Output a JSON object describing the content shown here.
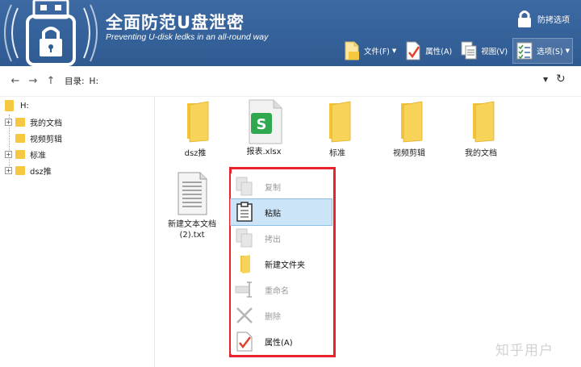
{
  "header": {
    "title": "全面防范U盘泄密",
    "subtitle": "Preventing U-disk ledks in an all-round way",
    "lock_label": "防拷选项",
    "logo_icon": "usb-lock-icon"
  },
  "toolbar": {
    "file": "文件(F)",
    "properties": "属性(A)",
    "view": "视图(V)",
    "options": "选项(S)"
  },
  "address": {
    "label": "目录:",
    "value": "H:"
  },
  "tree": {
    "root": "H:",
    "items": [
      {
        "label": "我的文档",
        "expandable": true
      },
      {
        "label": "视频剪辑",
        "expandable": false
      },
      {
        "label": "标准",
        "expandable": true
      },
      {
        "label": "dsz推",
        "expandable": true
      }
    ]
  },
  "files": [
    {
      "name": "dsz推",
      "type": "folder-icon"
    },
    {
      "name": "报表.xlsx",
      "type": "spreadsheet-icon"
    },
    {
      "name": "标准",
      "type": "folder-icon"
    },
    {
      "name": "视频剪辑",
      "type": "folder-icon"
    },
    {
      "name": "我的文档",
      "type": "folder-icon"
    },
    {
      "name": "新建文本文档\n(2).txt",
      "type": "text-file-icon"
    }
  ],
  "context_menu": {
    "items": [
      {
        "label": "复制",
        "enabled": false,
        "icon": "copy-icon"
      },
      {
        "label": "粘贴",
        "enabled": true,
        "icon": "paste-icon",
        "highlighted": true
      },
      {
        "label": "拷出",
        "enabled": false,
        "icon": "export-icon"
      },
      {
        "label": "新建文件夹",
        "enabled": true,
        "icon": "new-folder-icon"
      },
      {
        "label": "重命名",
        "enabled": false,
        "icon": "rename-icon"
      },
      {
        "label": "删除",
        "enabled": false,
        "icon": "delete-icon"
      },
      {
        "label": "属性(A)",
        "enabled": true,
        "icon": "properties-icon"
      }
    ]
  },
  "watermark": "知乎用户",
  "colors": {
    "header_bg": "#2f5a92",
    "folder": "#f6c842",
    "highlight": "#cce4f7",
    "frame": "#e8232c"
  }
}
